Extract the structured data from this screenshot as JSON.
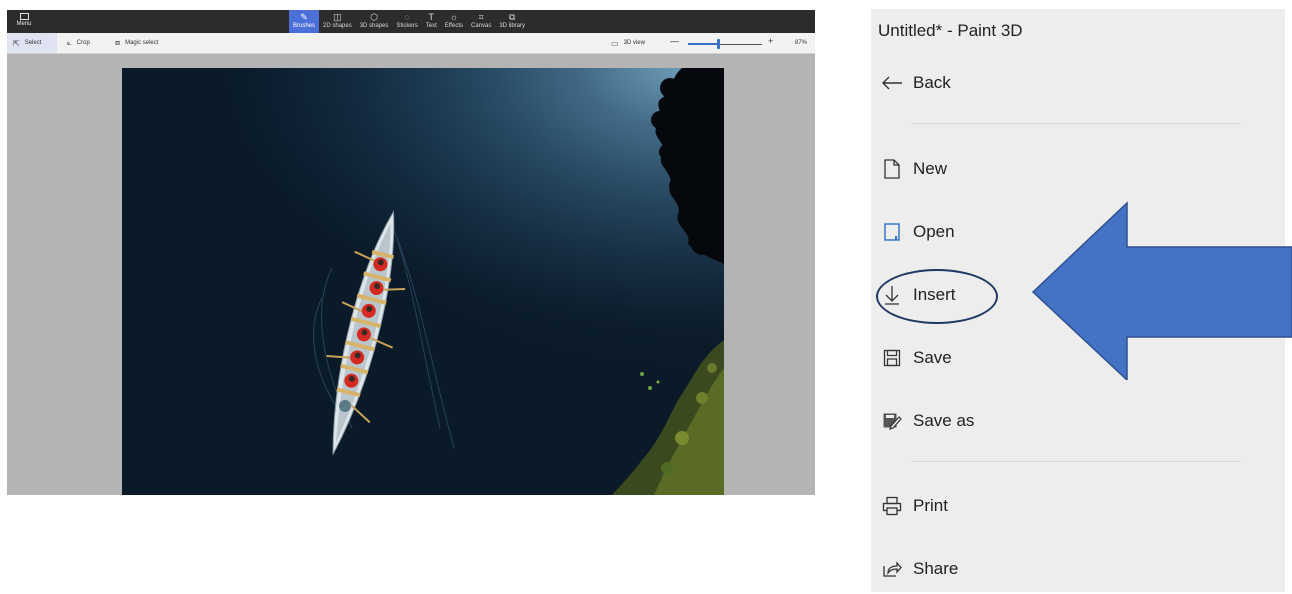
{
  "paint_app": {
    "menu_label": "Menu",
    "tools": [
      {
        "label": "Brushes",
        "icon": "brush-icon",
        "glyph": "✎",
        "active": true
      },
      {
        "label": "2D shapes",
        "icon": "2d-shapes-icon",
        "glyph": "◫",
        "active": false
      },
      {
        "label": "3D shapes",
        "icon": "3d-shapes-icon",
        "glyph": "⬡",
        "active": false
      },
      {
        "label": "Stickers",
        "icon": "stickers-icon",
        "glyph": "◌",
        "active": false
      },
      {
        "label": "Text",
        "icon": "text-icon",
        "glyph": "T",
        "active": false
      },
      {
        "label": "Effects",
        "icon": "effects-icon",
        "glyph": "☼",
        "active": false
      },
      {
        "label": "Canvas",
        "icon": "canvas-icon",
        "glyph": "⌗",
        "active": false
      },
      {
        "label": "3D library",
        "icon": "3d-library-icon",
        "glyph": "⧉",
        "active": false
      }
    ],
    "toolbar": {
      "select_label": "Select",
      "crop_label": "Crop",
      "magic_select_label": "Magic select",
      "view_3d_label": "3D view",
      "zoom_minus": "—",
      "zoom_plus": "+",
      "zoom_level": "87%",
      "zoom_fraction": 0.4
    }
  },
  "file_menu": {
    "title": "Untitled* - Paint 3D",
    "back_label": "Back",
    "items": [
      {
        "label": "New",
        "icon": "new-file-icon"
      },
      {
        "label": "Open",
        "icon": "open-folder-icon"
      },
      {
        "label": "Insert",
        "icon": "insert-download-icon",
        "highlighted": true
      },
      {
        "label": "Save",
        "icon": "save-disk-icon"
      },
      {
        "label": "Save as",
        "icon": "save-as-icon"
      },
      {
        "label": "Print",
        "icon": "printer-icon"
      },
      {
        "label": "Share",
        "icon": "share-icon"
      }
    ]
  },
  "annotation": {
    "arrow_color": "#4472c4",
    "arrow_border_color": "#2f528f",
    "highlight_circle_color": "#203864"
  }
}
